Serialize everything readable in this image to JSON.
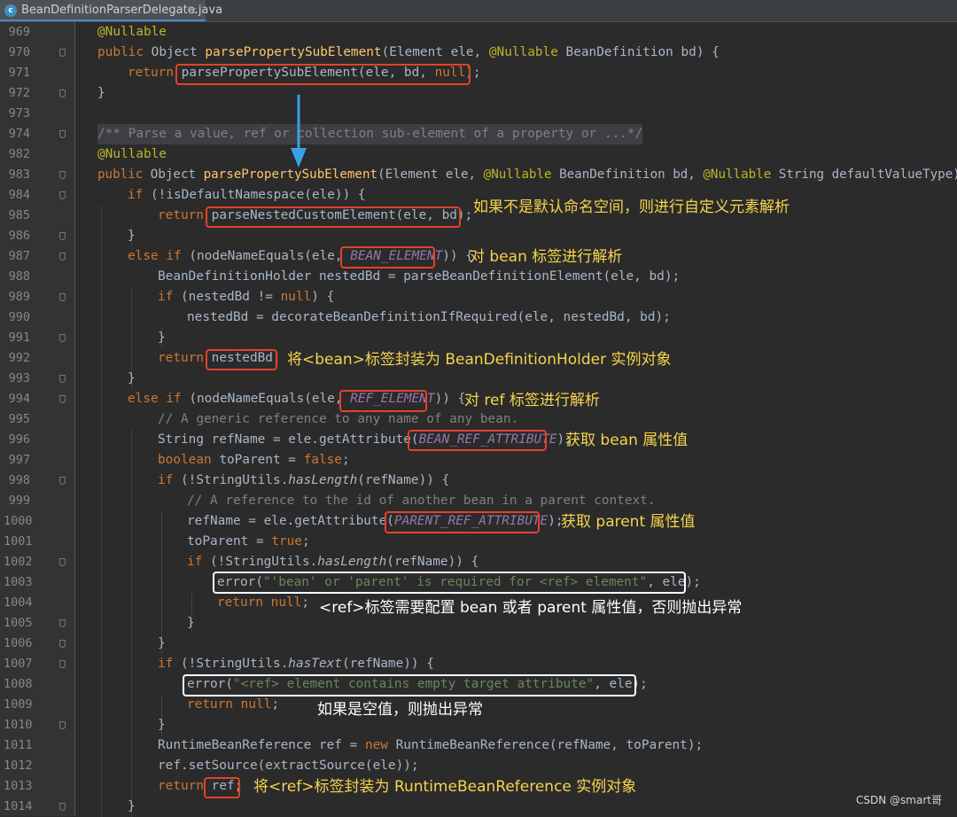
{
  "tab": {
    "icon": "c",
    "file_name": "BeanDefinitionParserDelegate.java",
    "close": "×"
  },
  "line_numbers": [
    "969",
    "970",
    "971",
    "972",
    "973",
    "974",
    "982",
    "983",
    "984",
    "985",
    "986",
    "987",
    "988",
    "989",
    "990",
    "991",
    "992",
    "993",
    "994",
    "995",
    "996",
    "997",
    "998",
    "999",
    "1000",
    "1001",
    "1002",
    "1003",
    "1004",
    "1005",
    "1006",
    "1007",
    "1008",
    "1009",
    "1010",
    "1011",
    "1012",
    "1013",
    "1014"
  ],
  "code": {
    "r0": {
      "a": "@Nullable"
    },
    "r1": {
      "k1": "public ",
      "t1": "Object ",
      "m": "parsePropertySubElement",
      "t2": "(Element ele, ",
      "a": "@Nullable",
      "t3": " BeanDefinition bd) {"
    },
    "r2": {
      "k": "return ",
      "t1": "parsePropertySubElement(ele, bd, ",
      "k2": "null",
      "t2": ");"
    },
    "r3": {
      "t": "}"
    },
    "r5": {
      "c": "/** Parse a value, ref or collection sub-element of a property or ...*/"
    },
    "r6": {
      "a": "@Nullable"
    },
    "r7": {
      "k1": "public ",
      "t1": "Object ",
      "m": "parsePropertySubElement",
      "t2": "(Element ele, ",
      "a1": "@Nullable",
      "t3": " BeanDefinition bd, ",
      "a2": "@Nullable",
      "t4": " String defaultValueType) {"
    },
    "r8": {
      "k": "if ",
      "t": "(!isDefaultNamespace(ele)) {"
    },
    "r9": {
      "k": "return ",
      "t": "parseNestedCustomElement(ele, bd);"
    },
    "r10": {
      "t": "}"
    },
    "r11": {
      "k": "else if ",
      "t1": "(nodeNameEquals(ele, ",
      "f": "BEAN_ELEMENT",
      "t2": ")) {"
    },
    "r12": {
      "t": "BeanDefinitionHolder nestedBd = parseBeanDefinitionElement(ele, bd);"
    },
    "r13": {
      "k1": "if ",
      "t1": "(nestedBd != ",
      "k2": "null",
      "t2": ") {"
    },
    "r14": {
      "t": "nestedBd = decorateBeanDefinitionIfRequired(ele, nestedBd, bd);"
    },
    "r15": {
      "t": "}"
    },
    "r16": {
      "k": "return ",
      "t": "nestedBd;"
    },
    "r17": {
      "t": "}"
    },
    "r18": {
      "k": "else if ",
      "t1": "(nodeNameEquals(ele, ",
      "f": "REF_ELEMENT",
      "t2": ")) {"
    },
    "r19": {
      "c": "// A generic reference to any name of any bean."
    },
    "r20": {
      "t1": "String refName = ele.getAttribute(",
      "f": "BEAN_REF_ATTRIBUTE",
      "t2": ");"
    },
    "r21": {
      "k1": "boolean ",
      "t": "toParent = ",
      "k2": "false",
      "t2": ";"
    },
    "r22": {
      "k": "if ",
      "t1": "(!StringUtils.",
      "i": "hasLength",
      "t2": "(refName)) {"
    },
    "r23": {
      "c": "// A reference to the id of another bean in a parent context."
    },
    "r24": {
      "t1": "refName = ele.getAttribute(",
      "f": "PARENT_REF_ATTRIBUTE",
      "t2": ");"
    },
    "r25": {
      "t": "toParent = ",
      "k": "true",
      "t2": ";"
    },
    "r26": {
      "k": "if ",
      "t1": "(!StringUtils.",
      "i": "hasLength",
      "t2": "(refName)) {"
    },
    "r27": {
      "t1": "error(",
      "s": "\"'bean' or 'parent' is required for <ref> element\"",
      "t2": ", ele);"
    },
    "r28": {
      "k1": "return ",
      "k2": "null",
      "t": ";"
    },
    "r29": {
      "t": "}"
    },
    "r30": {
      "t": "}"
    },
    "r31": {
      "k": "if ",
      "t1": "(!StringUtils.",
      "i": "hasText",
      "t2": "(refName)) {"
    },
    "r32": {
      "t1": "error(",
      "s": "\"<ref> element contains empty target attribute\"",
      "t2": ", ele);"
    },
    "r33": {
      "k1": "return ",
      "k2": "null",
      "t": ";"
    },
    "r34": {
      "t": "}"
    },
    "r35": {
      "t1": "RuntimeBeanReference ref = ",
      "k": "new ",
      "t2": "RuntimeBeanReference(refName, toParent);"
    },
    "r36": {
      "t": "ref.setSource(extractSource(ele));"
    },
    "r37": {
      "k": "return ",
      "t": "ref;"
    },
    "r38": {
      "t": "}"
    }
  },
  "annotations": {
    "custom_element": "如果不是默认命名空间，则进行自定义元素解析",
    "bean_tag": "对 bean 标签进行解析",
    "bean_holder": "将<bean>标签封装为 BeanDefinitionHolder 实例对象",
    "ref_tag": "对 ref 标签进行解析",
    "get_bean": "获取 bean 属性值",
    "get_parent": "获取 parent 属性值",
    "ref_error": "<ref>标签需要配置 bean 或者 parent 属性值，否则抛出异常",
    "empty_error": "如果是空值，则抛出异常",
    "ref_wrap": "将<ref>标签封装为 RuntimeBeanReference 实例对象"
  },
  "watermark": "CSDN @smart哥",
  "colors": {
    "background": "#2b2b2b",
    "keyword": "#cc7832",
    "method": "#ffc66d",
    "annotation": "#bbb529",
    "constant": "#9876aa",
    "string": "#6a8759",
    "comment": "#808080",
    "red_box": "#e3412b",
    "note_text": "#f6d44b",
    "arrow": "#3aa0e8"
  }
}
